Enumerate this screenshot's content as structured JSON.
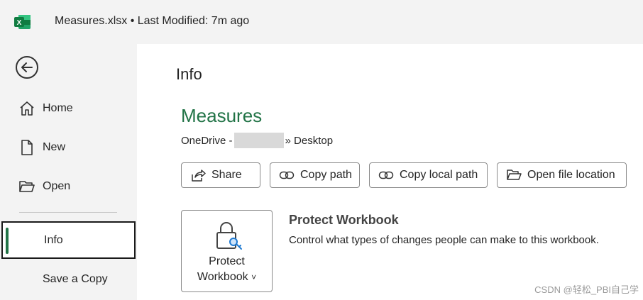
{
  "titlebar": {
    "title": "Measures.xlsx • Last Modified: 7m ago",
    "app_icon": "excel-logo-icon",
    "brand_color": "#217346"
  },
  "sidebar": {
    "back_icon": "back-arrow-icon",
    "items": [
      {
        "label": "Home",
        "icon": "home-icon"
      },
      {
        "label": "New",
        "icon": "new-document-icon"
      },
      {
        "label": "Open",
        "icon": "folder-open-icon"
      },
      {
        "label": "Info",
        "active": true
      },
      {
        "label": "Save a Copy"
      }
    ]
  },
  "main": {
    "page_title": "Info",
    "doc_name": "Measures",
    "path_prefix": "OneDrive -",
    "path_suffix": "» Desktop",
    "buttons": [
      {
        "label": "Share",
        "icon": "share-icon"
      },
      {
        "label": "Copy path",
        "icon": "link-icon"
      },
      {
        "label": "Copy local path",
        "icon": "link-icon"
      },
      {
        "label": "Open file location",
        "icon": "folder-open-icon"
      }
    ],
    "protect": {
      "tile_line1": "Protect",
      "tile_line2": "Workbook",
      "tile_chevron": "˅",
      "heading": "Protect Workbook",
      "description": "Control what types of changes people can make to this workbook."
    }
  },
  "watermark": "CSDN @轻松_PBI自己学"
}
